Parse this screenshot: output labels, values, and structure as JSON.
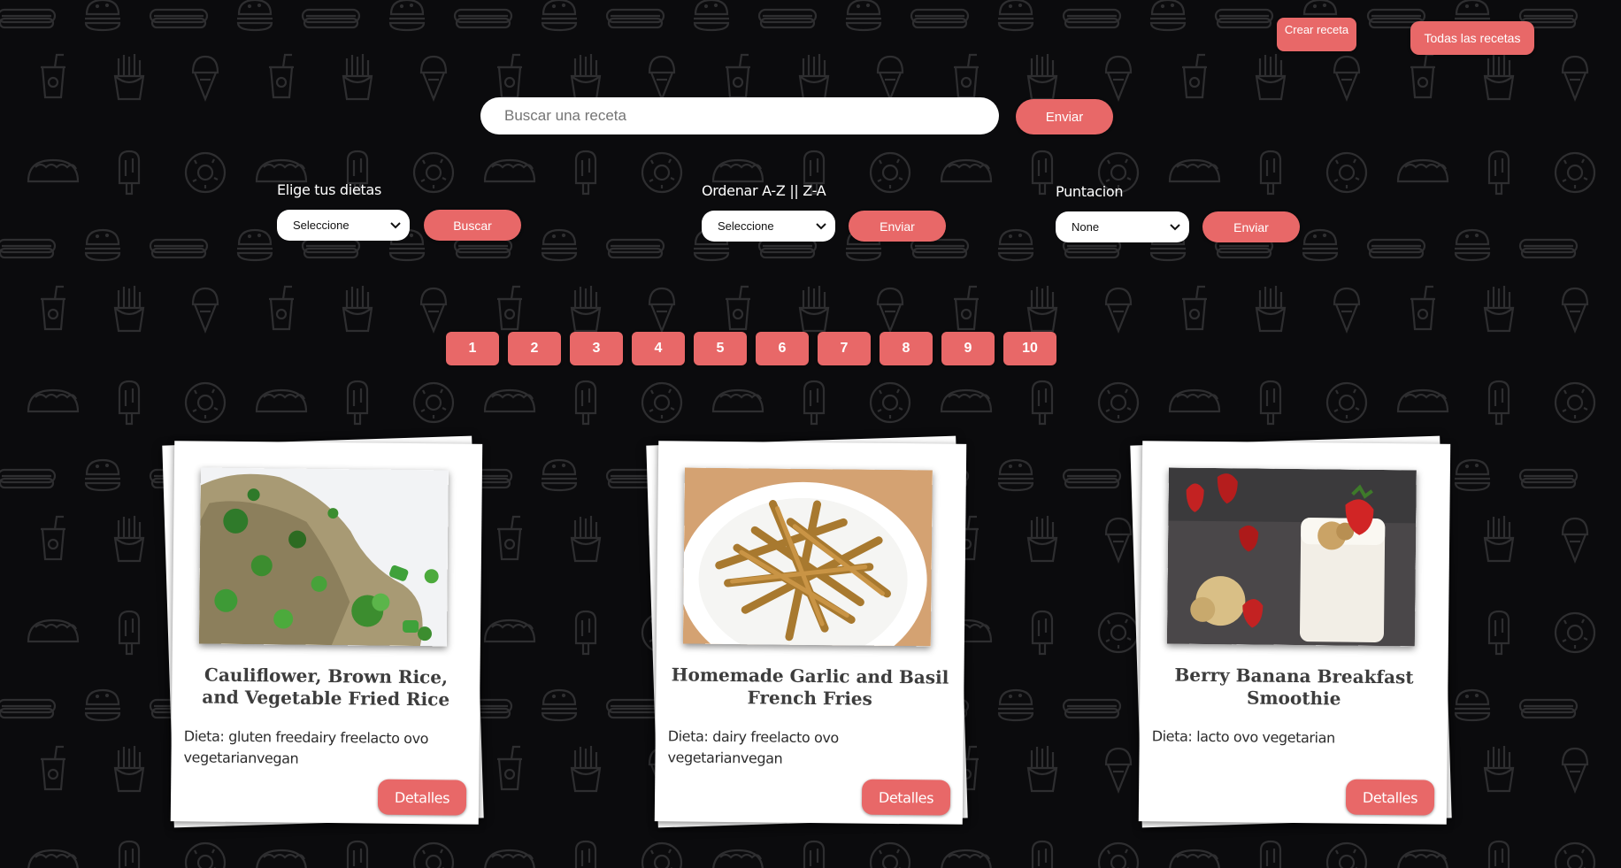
{
  "header": {
    "create_recipe_label": "Crear receta",
    "all_recipes_label": "Todas las recetas"
  },
  "search": {
    "placeholder": "Buscar una receta",
    "value": "",
    "submit_label": "Enviar"
  },
  "filters": {
    "diet": {
      "label": "Elige tus dietas",
      "selected": "Seleccione",
      "button_label": "Buscar"
    },
    "order": {
      "label": "Ordenar A-Z || Z-A",
      "selected": "Seleccione",
      "button_label": "Enviar"
    },
    "score": {
      "label": "Puntacion",
      "selected": "None",
      "button_label": "Enviar"
    }
  },
  "pagination": {
    "pages": [
      "1",
      "2",
      "3",
      "4",
      "5",
      "6",
      "7",
      "8",
      "9",
      "10"
    ]
  },
  "cards": [
    {
      "title": "Cauliflower, Brown Rice, and Vegetable Fried Rice",
      "diet": "Dieta: gluten freedairy freelacto ovo vegetarianvegan",
      "details_label": "Detalles",
      "image": "fried-rice-photo"
    },
    {
      "title": "Homemade Garlic and Basil French Fries",
      "diet": "Dieta: dairy freelacto ovo vegetarianvegan",
      "details_label": "Detalles",
      "image": "french-fries-photo"
    },
    {
      "title": "Berry Banana Breakfast Smoothie",
      "diet": "Dieta: lacto ovo vegetarian",
      "details_label": "Detalles",
      "image": "smoothie-photo"
    }
  ],
  "colors": {
    "background": "#0b0b0d",
    "pattern": "#2e2e30",
    "accent": "#e86868",
    "card": "#ffffff",
    "title_text": "#3d3d3d"
  },
  "icons": {
    "background_pattern": [
      "burger-icon",
      "hotdog-icon",
      "soda-cup-icon",
      "fries-icon",
      "ice-cream-cone-icon",
      "popsicle-icon",
      "donut-icon",
      "taco-icon"
    ],
    "select_chevron": "chevron-down-icon"
  }
}
